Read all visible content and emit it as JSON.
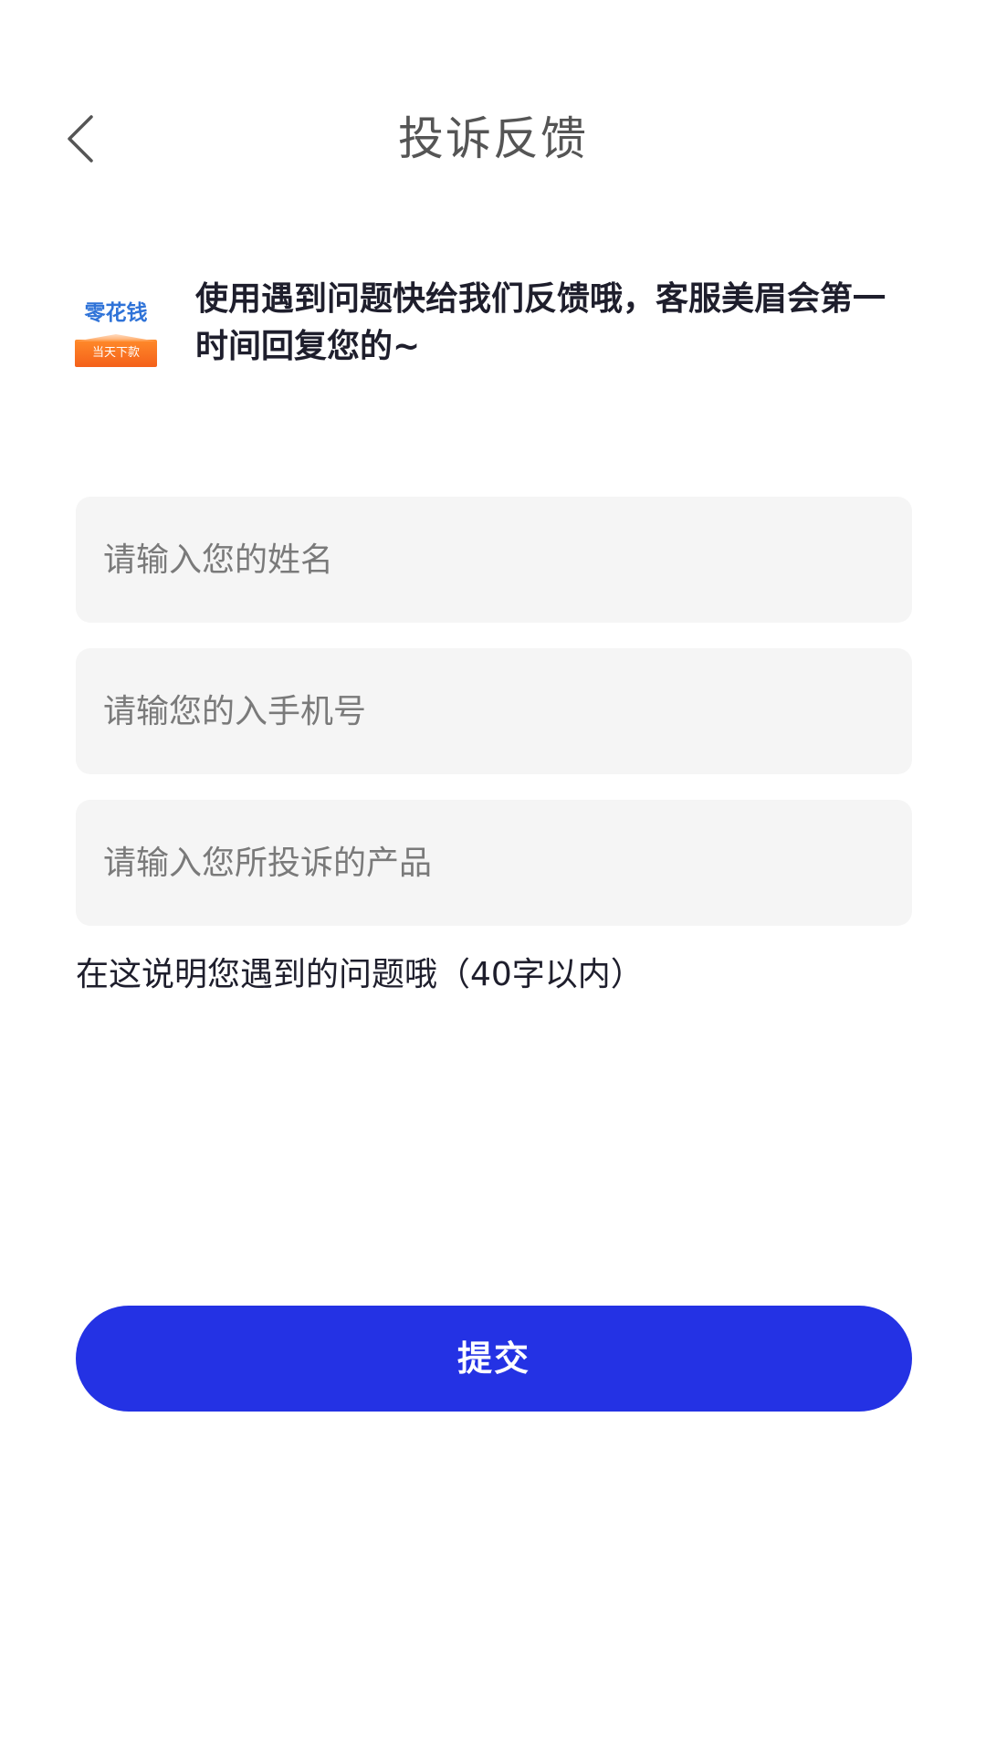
{
  "header": {
    "title": "投诉反馈",
    "back_icon": "chevron-left-icon"
  },
  "intro": {
    "logo_text_top": "零花钱",
    "logo_text_bottom": "当天下款",
    "message": "使用遇到问题快给我们反馈哦，客服美眉会第一时间回复您的~"
  },
  "form": {
    "name_placeholder": "请输入您的姓名",
    "phone_placeholder": "请输您的入手机号",
    "product_placeholder": "请输入您所投诉的产品",
    "description_placeholder": "在这说明您遇到的问题哦（40字以内）",
    "submit_label": "提交"
  },
  "colors": {
    "accent": "#2432e4",
    "field_bg": "#f5f5f5",
    "logo_blue": "#2f73d8",
    "logo_orange": "#f4601a"
  }
}
